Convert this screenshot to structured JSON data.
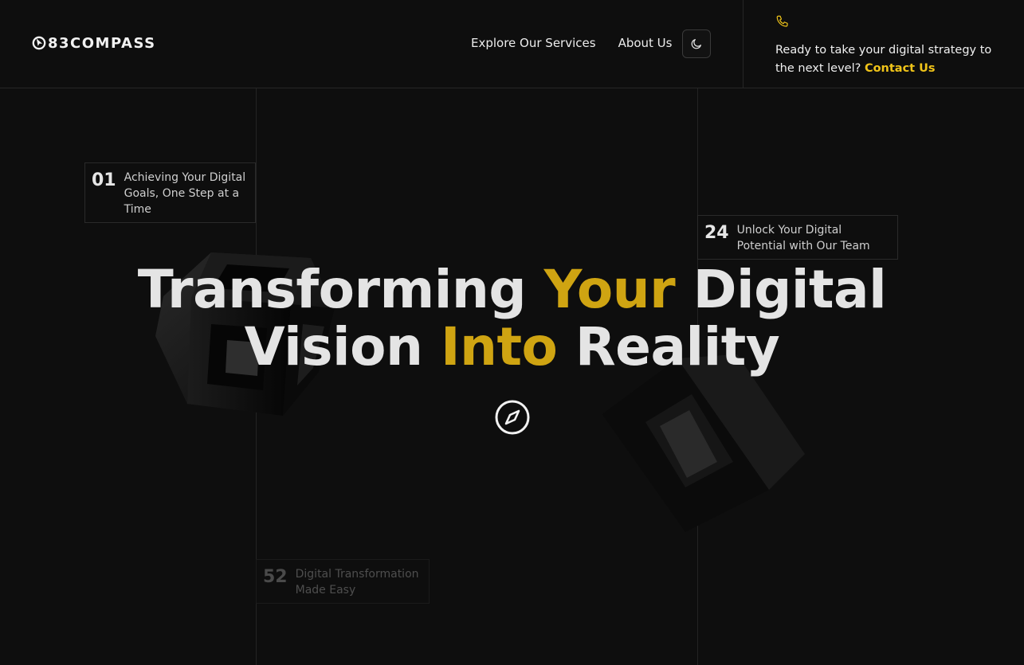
{
  "brand": {
    "name": "83COMPASS"
  },
  "nav": {
    "items": [
      "Explore Our Services",
      "About Us"
    ]
  },
  "theme_toggle": {
    "icon": "moon-icon"
  },
  "cta": {
    "icon": "phone-icon",
    "text": "Ready to take your digital strategy to the next level?",
    "link": "Contact Us"
  },
  "stats": [
    {
      "number": "01",
      "label": "Achieving Your Digital Goals, One Step at a Time"
    },
    {
      "number": "24",
      "label": "Unlock Your Digital Potential with Our Team"
    },
    {
      "number": "52",
      "label": "Digital Transformation Made Easy"
    }
  ],
  "hero": {
    "line1_a": "Transforming",
    "line1_b": "Your",
    "line1_c": "Digital",
    "line2_a": "Vision",
    "line2_b": "Into",
    "line2_c": "Reality",
    "button_icon": "compass-icon"
  },
  "colors": {
    "background": "#0e0e0e",
    "accent": "#cfa412",
    "link_accent": "#f0c419",
    "text": "#e4e4e4"
  }
}
